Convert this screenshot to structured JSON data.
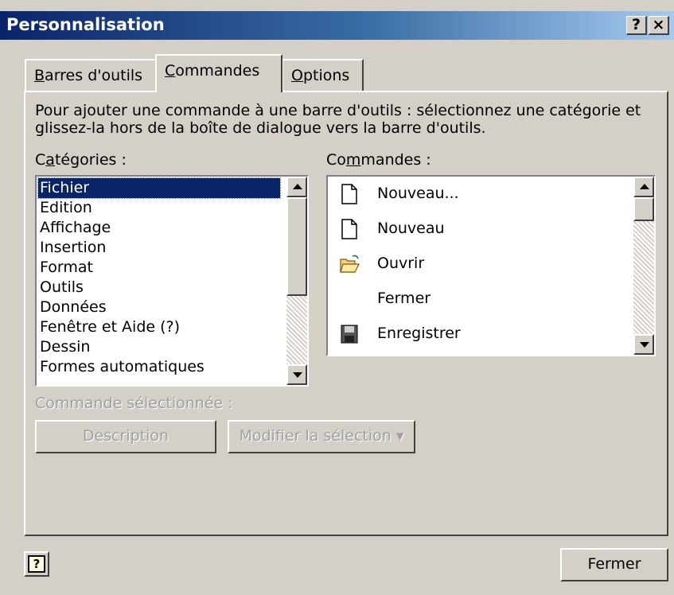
{
  "window": {
    "title": "Personnalisation",
    "help_button": "?",
    "close_button": "×"
  },
  "tabs": [
    {
      "label_pre": "",
      "accel": "B",
      "label_post": "arres d'outils"
    },
    {
      "label_pre": "",
      "accel": "C",
      "label_post": "ommandes"
    },
    {
      "label_pre": "",
      "accel": "O",
      "label_post": "ptions"
    }
  ],
  "instructions": {
    "line1": "Pour ajouter une commande à une barre d'outils : sélectionnez une catégorie et",
    "line2": "glissez-la hors de la boîte de dialogue vers la barre d'outils."
  },
  "categories": {
    "label_pre": "C",
    "label_accel": "a",
    "label_post": "tégories :",
    "items": [
      "Fichier",
      "Edition",
      "Affichage",
      "Insertion",
      "Format",
      "Outils",
      "Données",
      "Fenêtre et Aide (?)",
      "Dessin",
      "Formes automatiques"
    ],
    "selected": "Fichier"
  },
  "commands": {
    "label_pre": "Co",
    "label_accel": "m",
    "label_post": "mandes :",
    "items": [
      {
        "label": "Nouveau...",
        "icon": "new-document-icon"
      },
      {
        "label": "Nouveau",
        "icon": "new-document-icon"
      },
      {
        "label": "Ouvrir",
        "icon": "open-folder-icon"
      },
      {
        "label": "Fermer",
        "icon": ""
      },
      {
        "label": "Enregistrer",
        "icon": "floppy-disk-icon"
      }
    ]
  },
  "selected_command": {
    "label": "Commande sélectionnée :",
    "description_button": "Description",
    "modify_button": "Modifier la sélection",
    "modify_arrow": "▾"
  },
  "footer": {
    "help_icon": "?",
    "close_button": "Fermer"
  },
  "colors": {
    "face": "#d4d0c8",
    "titlebar_start": "#0a246a",
    "titlebar_end": "#a6caf0",
    "selection": "#0a246a",
    "disabled_text": "#a0a0a0"
  }
}
